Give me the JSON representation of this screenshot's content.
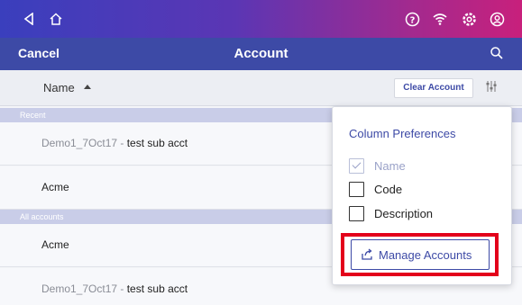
{
  "header": {
    "cancel_label": "Cancel",
    "title": "Account"
  },
  "table_header": {
    "column_label": "Name",
    "clear_label": "Clear Account"
  },
  "sections": {
    "recent": "Recent",
    "all": "All accounts"
  },
  "recent_rows": [
    {
      "code": "Demo1_7Oct17",
      "sep": " - ",
      "name": "test sub acct"
    },
    {
      "code": "",
      "sep": "",
      "name": "Acme"
    }
  ],
  "all_rows": [
    {
      "code": "",
      "sep": "",
      "name": "Acme"
    },
    {
      "code": "Demo1_7Oct17",
      "sep": " - ",
      "name": "test sub acct"
    }
  ],
  "column_preferences": {
    "title": "Column Preferences",
    "options": [
      {
        "label": "Name",
        "checked": true,
        "disabled": true
      },
      {
        "label": "Code",
        "checked": false,
        "disabled": false
      },
      {
        "label": "Description",
        "checked": false,
        "disabled": false
      }
    ],
    "manage_label": "Manage  Accounts"
  },
  "colors": {
    "primary": "#3d4aa6",
    "highlight": "#e3001b"
  },
  "icons": {
    "system": [
      "back-icon",
      "home-icon",
      "help-icon",
      "wifi-icon",
      "settings-icon",
      "account-icon"
    ],
    "search": "search-icon",
    "prefs": "sliders-icon",
    "manage": "export-icon"
  }
}
